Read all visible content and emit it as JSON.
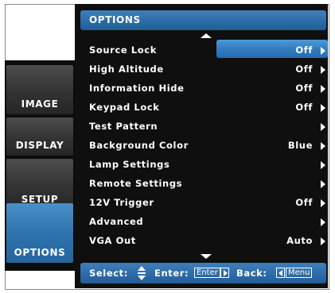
{
  "header": {
    "title": "OPTIONS"
  },
  "tabs": [
    {
      "label": "IMAGE",
      "active": false
    },
    {
      "label": "DISPLAY",
      "active": false
    },
    {
      "label": "SETUP",
      "active": false
    },
    {
      "label": "OPTIONS",
      "active": true
    }
  ],
  "menu": {
    "items": [
      {
        "label": "Source Lock",
        "value": "Off",
        "has_arrow": true
      },
      {
        "label": "High Altitude",
        "value": "Off",
        "has_arrow": true
      },
      {
        "label": "Information Hide",
        "value": "Off",
        "has_arrow": true
      },
      {
        "label": "Keypad Lock",
        "value": "Off",
        "has_arrow": true
      },
      {
        "label": "Test Pattern",
        "value": "",
        "has_arrow": true
      },
      {
        "label": "Background Color",
        "value": "Blue",
        "has_arrow": true
      },
      {
        "label": "Lamp Settings",
        "value": "",
        "has_arrow": true
      },
      {
        "label": "Remote Settings",
        "value": "",
        "has_arrow": true
      },
      {
        "label": "12V Trigger",
        "value": "Off",
        "has_arrow": true
      },
      {
        "label": "Advanced",
        "value": "",
        "has_arrow": true
      },
      {
        "label": "VGA Out",
        "value": "Auto",
        "has_arrow": true
      }
    ],
    "selected_index": 0
  },
  "footer": {
    "select_label": "Select:",
    "enter_label": "Enter:",
    "enter_key": "Enter",
    "back_label": "Back:",
    "back_key": "Menu"
  },
  "colors": {
    "accent": "#2f7ac0",
    "background": "#0f0f0f",
    "text": "#ffffff"
  },
  "icons": [
    "scroll-up-icon",
    "scroll-down-icon",
    "chevron-right-icon",
    "updown-icon"
  ]
}
